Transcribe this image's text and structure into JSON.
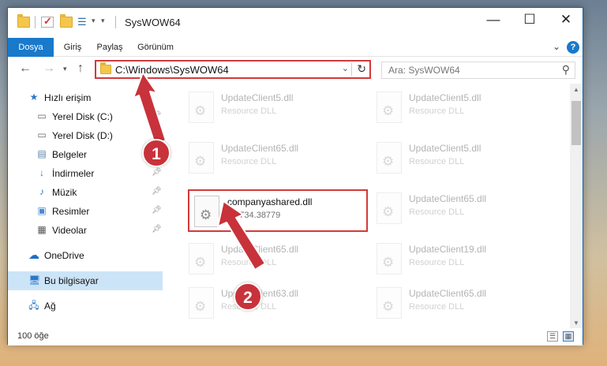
{
  "window": {
    "title": "SysWOW64",
    "controls": {
      "minimize": "—",
      "maximize": "☐",
      "close": "✕"
    }
  },
  "ribbon": {
    "tabs": [
      "Dosya",
      "Giriş",
      "Paylaş",
      "Görünüm"
    ],
    "help": "?"
  },
  "address": {
    "path": "C:\\Windows\\SysWOW64",
    "search_placeholder": "Ara: SysWOW64"
  },
  "nav_pane": {
    "items": [
      {
        "label": "Hızlı erişim",
        "icon": "star-icon"
      },
      {
        "label": "Yerel Disk (C:)",
        "icon": "drive-icon",
        "pinned": true
      },
      {
        "label": "Yerel Disk (D:)",
        "icon": "drive-icon"
      },
      {
        "label": "Belgeler",
        "icon": "documents-icon",
        "pinned": true
      },
      {
        "label": "İndirmeler",
        "icon": "download-icon",
        "pinned": true
      },
      {
        "label": "Müzik",
        "icon": "music-icon",
        "pinned": true
      },
      {
        "label": "Resimler",
        "icon": "pictures-icon",
        "pinned": true
      },
      {
        "label": "Videolar",
        "icon": "video-icon",
        "pinned": true
      },
      {
        "label": "OneDrive",
        "icon": "cloud-icon"
      },
      {
        "label": "Bu bilgisayar",
        "icon": "computer-icon",
        "selected": true
      },
      {
        "label": "Ağ",
        "icon": "network-icon"
      }
    ]
  },
  "files": [
    {
      "name": "UpdateClient5.dll",
      "desc": "Resource DLL"
    },
    {
      "name": "UpdateClient5.dll",
      "desc": "Resource DLL"
    },
    {
      "name": "UpdateClient65.dll",
      "desc": "Resource DLL"
    },
    {
      "name": "UpdateClient5.dll",
      "desc": "Resource DLL"
    },
    {
      "name": "companyashared.dll",
      "desc": "10.734.38779",
      "highlighted": true
    },
    {
      "name": "UpdateClient65.dll",
      "desc": "Resource DLL"
    },
    {
      "name": "UpdateClient65.dll",
      "desc": "Resource DLL"
    },
    {
      "name": "UpdateClient19.dll",
      "desc": "Resource DLL"
    },
    {
      "name": "UpdateClient63.dll",
      "desc": "Resource DLL"
    },
    {
      "name": "UpdateClient65.dll",
      "desc": "Resource DLL"
    }
  ],
  "status": {
    "item_count": "100 öğe"
  },
  "annotations": {
    "step1": "1",
    "step2": "2"
  },
  "colors": {
    "accent": "#1979ca",
    "highlight": "#d33a3a",
    "badge": "#c8323a"
  }
}
